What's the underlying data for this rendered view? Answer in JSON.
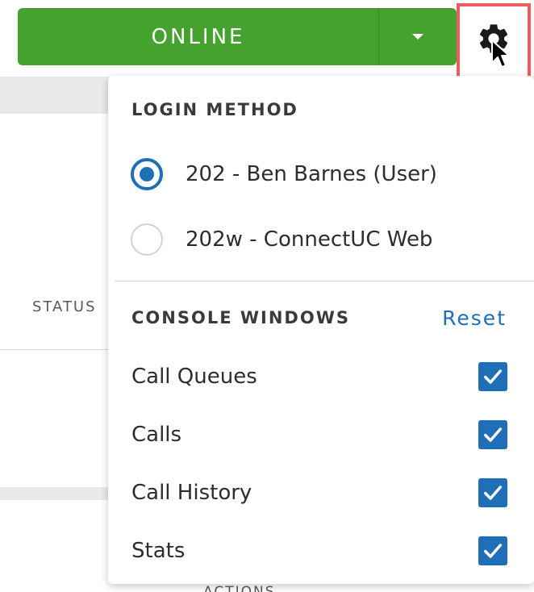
{
  "background": {
    "status_header": "STATUS",
    "actions_header": "ACTIONS"
  },
  "status_button": {
    "label": "ONLINE",
    "color": "#45a22f"
  },
  "settings": {
    "icon": "gear-icon",
    "highlight_color": "#ef5b5b"
  },
  "dropdown": {
    "login_method": {
      "title": "LOGIN METHOD",
      "options": [
        {
          "label": "202 - Ben Barnes (User)",
          "selected": true
        },
        {
          "label": "202w - ConnectUC Web",
          "selected": false
        }
      ]
    },
    "console_windows": {
      "title": "CONSOLE WINDOWS",
      "reset_label": "Reset",
      "items": [
        {
          "label": "Call Queues",
          "checked": true
        },
        {
          "label": "Calls",
          "checked": true
        },
        {
          "label": "Call History",
          "checked": true
        },
        {
          "label": "Stats",
          "checked": true
        }
      ]
    },
    "accent_color": "#1f6fb8"
  }
}
